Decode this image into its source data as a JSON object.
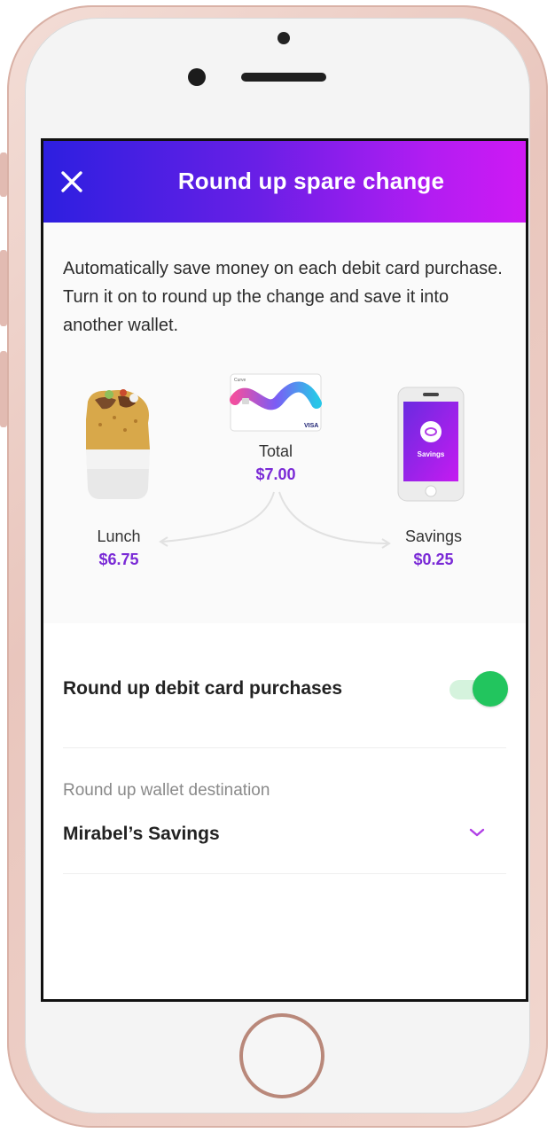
{
  "header": {
    "title": "Round up spare change",
    "gradient": [
      "#2d1fe0",
      "#cf19f4"
    ]
  },
  "intro": {
    "text": "Automatically save money on each debit card purchase. Turn it on to round up the change and save it into another wallet."
  },
  "illustration": {
    "total_label": "Total",
    "total_value": "$7.00",
    "lunch_label": "Lunch",
    "lunch_value": "$6.75",
    "savings_label": "Savings",
    "savings_value": "$0.25",
    "card_small_text": "Curve",
    "card_brand": "VISA",
    "phone_screen_text": "Savings",
    "accent_color": "#7a2ad6"
  },
  "toggle_row": {
    "label": "Round up debit card purchases",
    "enabled": true,
    "color": "#22c55e"
  },
  "destination": {
    "label": "Round up wallet destination",
    "value": "Mirabel’s Savings"
  },
  "icons": {
    "close": "close-icon",
    "chevron": "chevron-down-icon"
  }
}
